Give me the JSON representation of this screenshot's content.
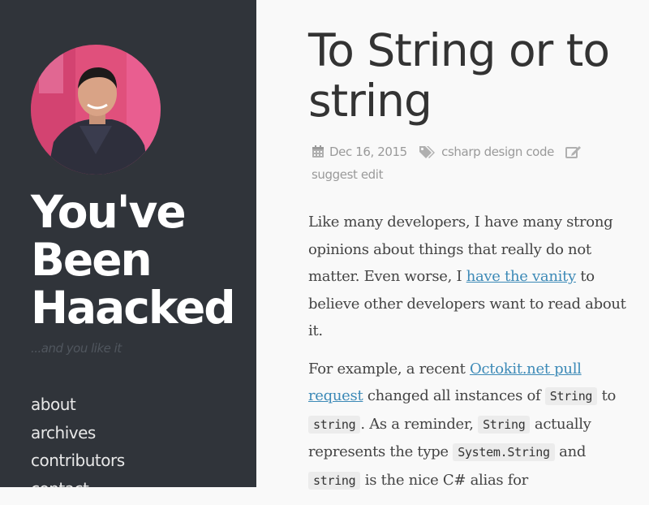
{
  "sidebar": {
    "title_lines": [
      "You've",
      "Been",
      "Haacked"
    ],
    "tagline": "...and you like it",
    "nav": [
      {
        "label": "about"
      },
      {
        "label": "archives"
      },
      {
        "label": "contributors"
      },
      {
        "label": "contact"
      }
    ]
  },
  "post": {
    "title": "To String or to string",
    "meta": {
      "date": "Dec 16, 2015",
      "tags": "csharp design code",
      "suggest_edit": "suggest edit"
    },
    "p1": {
      "text_before": "Like many developers, I have many strong opinions about things that really do not matter. Even worse, I ",
      "link": "have the vanity",
      "text_after": " to believe other developers want to read about it."
    },
    "p2": {
      "t1": "For example, a recent ",
      "link": "Octokit.net pull request",
      "t2": " changed all instances of ",
      "c1": "String",
      "t3": " to ",
      "c2": "string",
      "t4": ". As a reminder, ",
      "c3": "String",
      "t5": " actually represents the type ",
      "c4": "System.String",
      "t6": " and ",
      "c5": "string",
      "t7": " is the nice C# alias for"
    }
  },
  "colors": {
    "sidebar_bg": "#30343a",
    "link": "#3d8ab7",
    "title": "#333333",
    "meta": "#9a9a9a"
  }
}
